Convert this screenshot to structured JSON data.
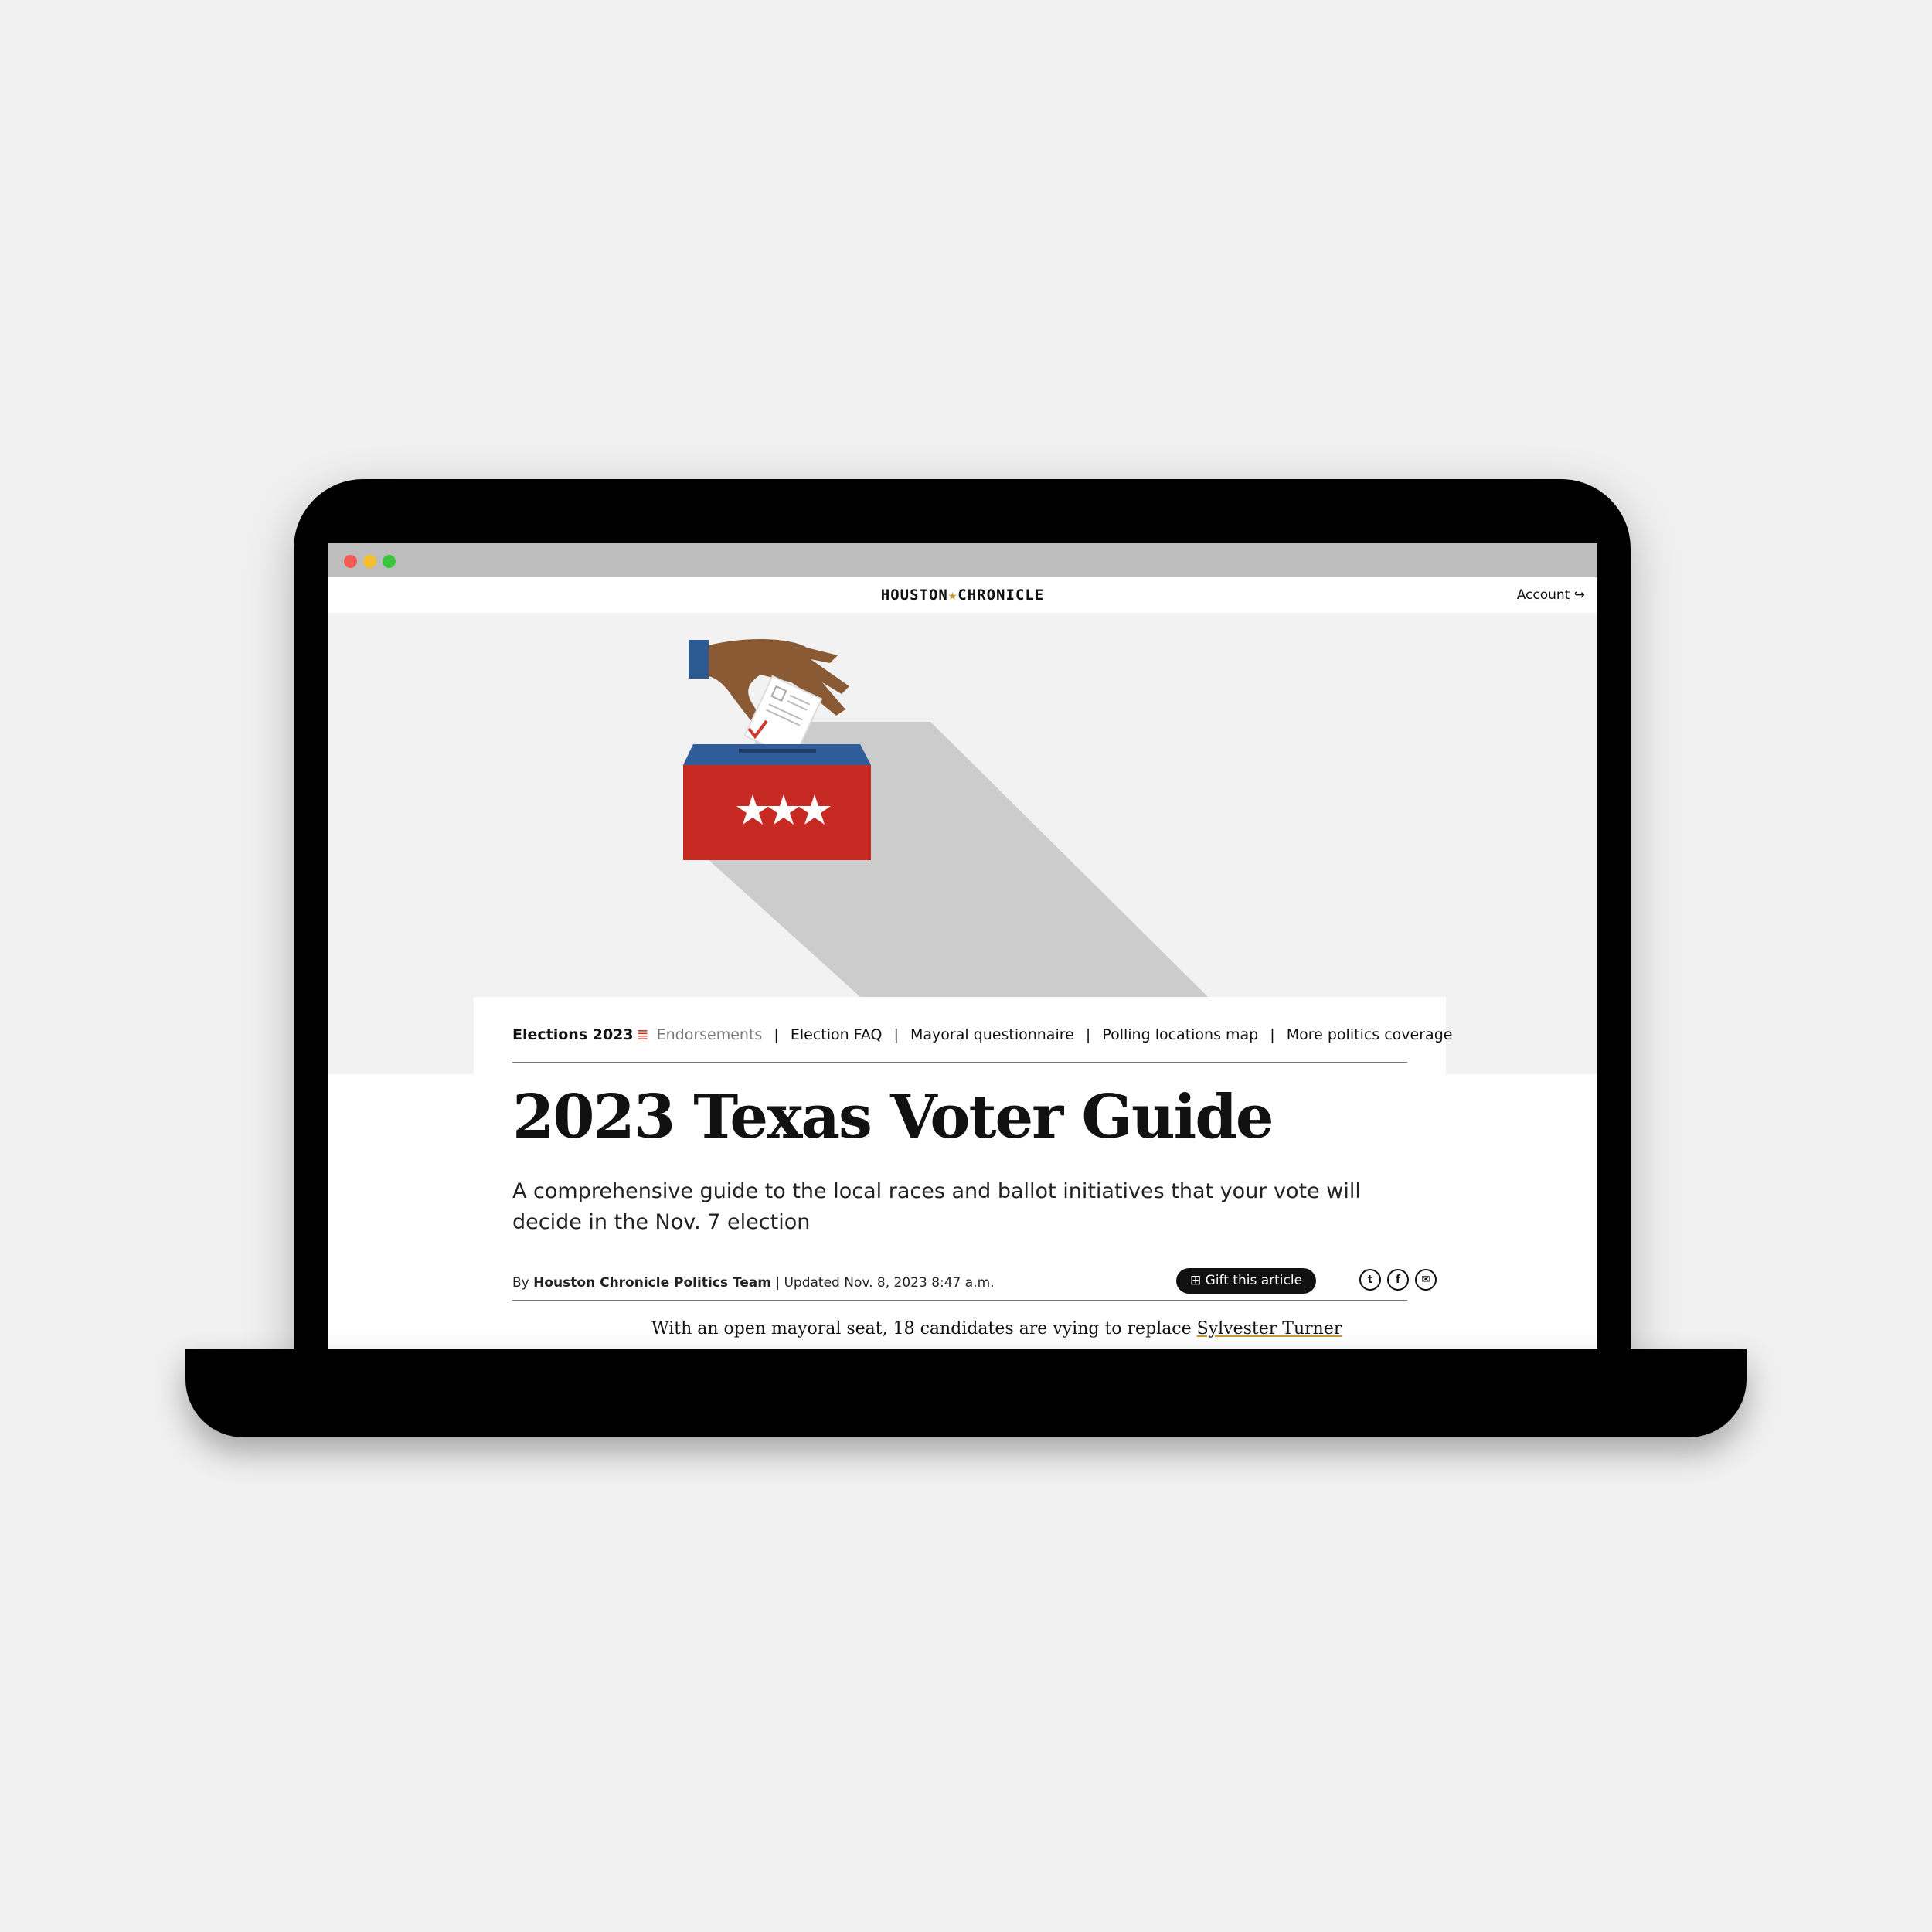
{
  "site": {
    "logo_left": "HOUSTON",
    "logo_star": "★",
    "logo_right": "CHRONICLE",
    "account_label": "Account",
    "account_icon": "↪"
  },
  "subnav": {
    "section": "Elections 2023",
    "flag_icon": "flag-icon",
    "items": [
      "Endorsements",
      "Election FAQ",
      "Mayoral questionnaire",
      "Polling locations map",
      "More politics coverage"
    ],
    "separator": "|"
  },
  "article": {
    "headline": "2023 Texas Voter Guide",
    "dek": "A comprehensive guide to the local races and ballot initiatives that your vote will decide in the Nov. 7 election",
    "byline_prefix": "By",
    "author": "Houston Chronicle Politics Team",
    "updated": "| Updated Nov. 8, 2023 8:47 a.m.",
    "gift_label": "Gift this article",
    "share_twitter": "t",
    "share_facebook": "f",
    "share_email": "✉",
    "body_start": "With an open mayoral seat, 18 candidates are vying to replace",
    "body_link": "Sylvester Turner"
  },
  "colors": {
    "ballot_box_red": "#c62a22",
    "ballot_box_blue": "#2f5d99",
    "sleeve_blue": "#2d5a92",
    "skin": "#8a5a35",
    "shadow": "#cccccc",
    "check_red": "#d0392b"
  }
}
